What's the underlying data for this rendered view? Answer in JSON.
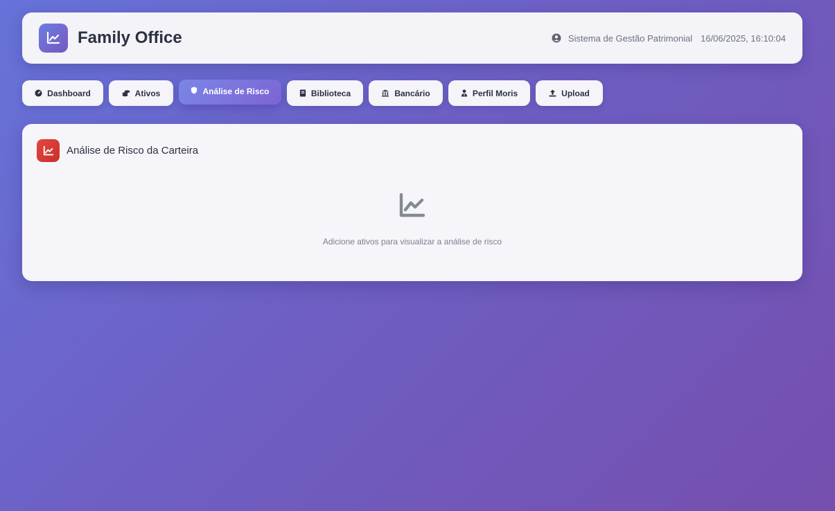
{
  "header": {
    "title": "Family Office",
    "logo_icon": "chart-line-icon",
    "subtitle": "Sistema de Gestão Patrimonial",
    "datetime": "16/06/2025, 16:10:04"
  },
  "tabs": [
    {
      "label": "Dashboard",
      "icon": "gauge-icon"
    },
    {
      "label": "Ativos",
      "icon": "coins-icon"
    },
    {
      "label": "Análise de Risco",
      "icon": "shield-icon",
      "active": true
    },
    {
      "label": "Biblioteca",
      "icon": "book-icon"
    },
    {
      "label": "Bancário",
      "icon": "bank-icon"
    },
    {
      "label": "Perfil Moris",
      "icon": "user-tie-icon"
    },
    {
      "label": "Upload",
      "icon": "upload-icon"
    }
  ],
  "panel": {
    "title": "Análise de Risco da Carteira",
    "empty_message": "Adicione ativos para visualizar a análise de risco"
  },
  "colors": {
    "accent": "#7b6ad8",
    "risk_icon": "#d63b33",
    "background_start": "#6673d9",
    "background_end": "#754fae"
  }
}
